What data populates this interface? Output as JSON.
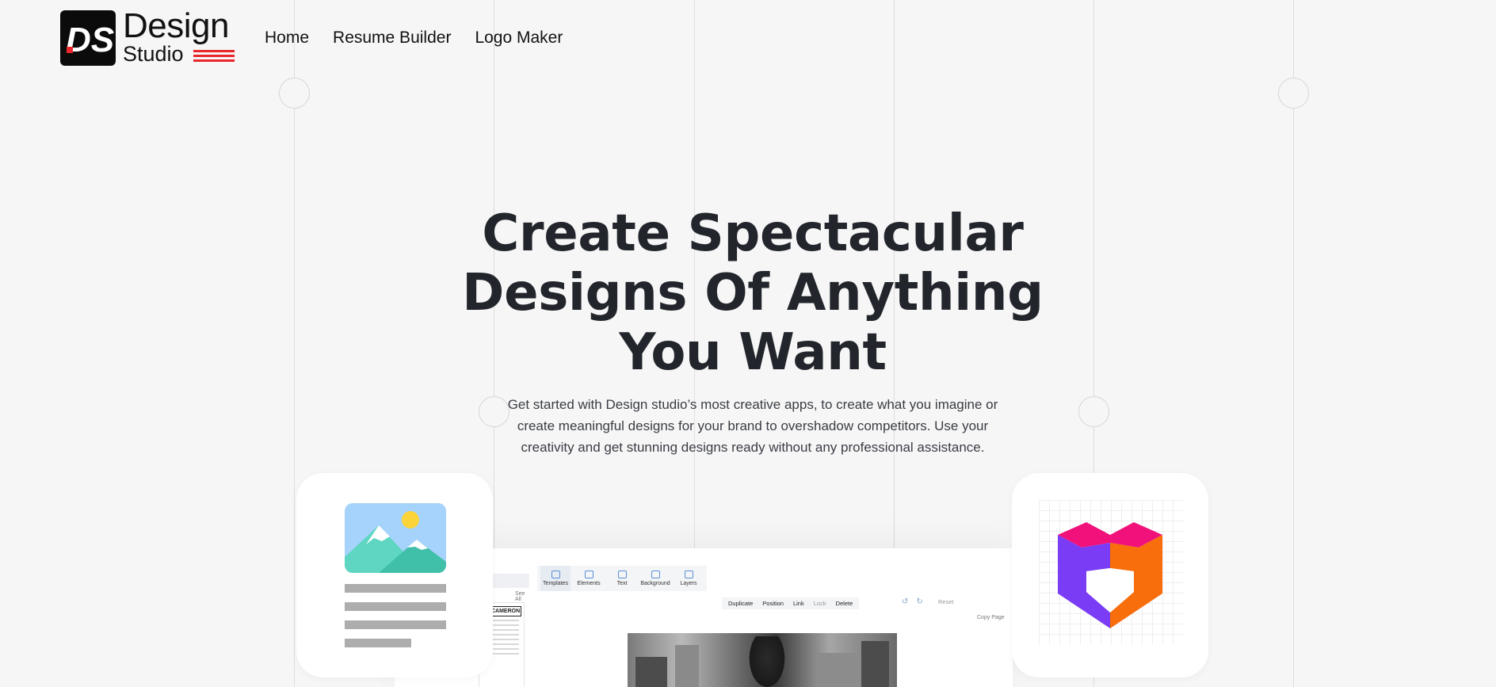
{
  "brand": {
    "word1": "Design",
    "word2": "Studio",
    "mark_letters": "DS",
    "accent": "#e8262b"
  },
  "nav": {
    "items": [
      {
        "label": "Home"
      },
      {
        "label": "Resume Builder"
      },
      {
        "label": "Logo Maker"
      }
    ]
  },
  "hero": {
    "title_line1": "Create Spectacular",
    "title_line2": "Designs Of Anything",
    "title_line3": "You Want",
    "subtitle_line1": "Get started with Design studio’s most creative apps, to create what you imagine or",
    "subtitle_line2": "create meaningful designs for your brand to overshadow competitors. Use your",
    "subtitle_line3": "creativity and get stunning designs ready without any professional assistance."
  },
  "cards": {
    "left_icon": "image-document-icon",
    "right_icon": "logo-maker-icon"
  },
  "preview": {
    "see_all": "See All",
    "resume_name": "LY CAMERON",
    "tools": [
      {
        "label": "Templates"
      },
      {
        "label": "Elements"
      },
      {
        "label": "Text"
      },
      {
        "label": "Background"
      },
      {
        "label": "Layers"
      }
    ],
    "actions": {
      "duplicate": "Duplicate",
      "position": "Position",
      "link": "Link",
      "lock": "Lock",
      "delete": "Delete"
    },
    "reset": "Reset",
    "copy_page": "Copy Page"
  },
  "colors": {
    "background": "#f6f6f6",
    "text": "#22252b"
  }
}
